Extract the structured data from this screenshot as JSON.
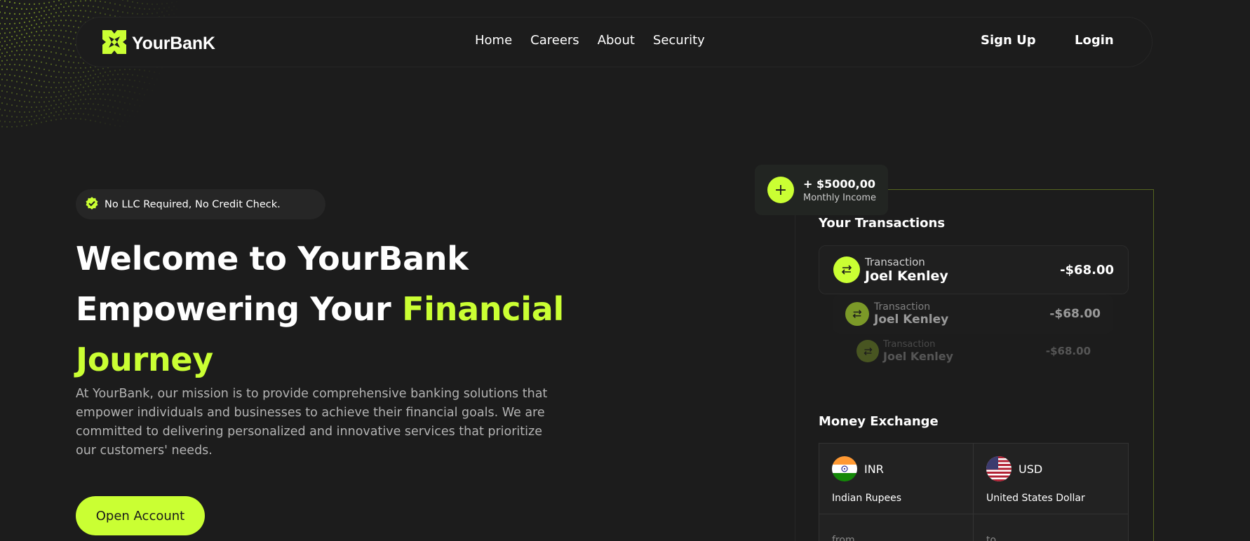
{
  "brand": {
    "name": "YourBanK",
    "accent": "#caff33",
    "background": "#1c1c1c"
  },
  "nav": {
    "links": [
      "Home",
      "Careers",
      "About",
      "Security"
    ],
    "signup": "Sign Up",
    "login": "Login"
  },
  "hero": {
    "badge": "No LLC Required, No Credit Check.",
    "line1": "Welcome to YourBank",
    "line2_plain": "Empowering Your ",
    "line2_accent": "Financial",
    "line3_accent": "Journey",
    "description": "At YourBank, our mission is to provide comprehensive banking solutions that empower individuals and businesses to achieve their financial goals. We are committed to delivering personalized and innovative services that prioritize our customers' needs.",
    "cta": "Open Account"
  },
  "income": {
    "amount": "+ $5000,00",
    "label": "Monthly Income"
  },
  "transactions": {
    "title": "Your Transactions",
    "items": [
      {
        "label": "Transaction",
        "name": "Joel Kenley",
        "amount": "-$68.00"
      },
      {
        "label": "Transaction",
        "name": "Joel Kenley",
        "amount": "-$68.00"
      },
      {
        "label": "Transaction",
        "name": "Joel Kenley",
        "amount": "-$68.00"
      }
    ]
  },
  "exchange": {
    "title": "Money Exchange",
    "from": {
      "code": "INR",
      "name": "Indian Rupees",
      "field": "from"
    },
    "to": {
      "code": "USD",
      "name": "United States Dollar",
      "field": "to"
    }
  },
  "icons": [
    "logo-icon",
    "check-badge-icon",
    "plus-icon",
    "transfer-icon",
    "india-flag-icon",
    "usa-flag-icon"
  ]
}
